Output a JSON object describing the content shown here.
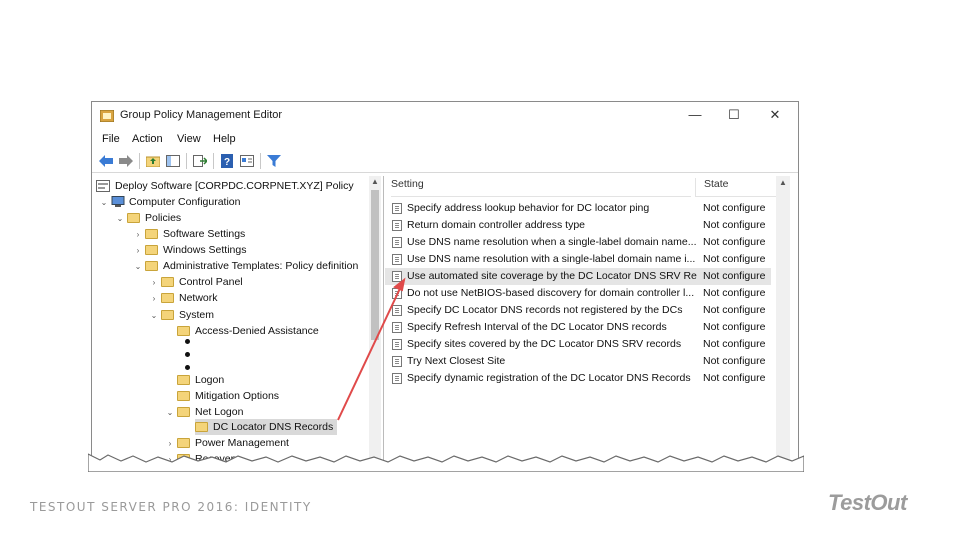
{
  "window": {
    "title": "Group Policy Management Editor",
    "minimize": "—",
    "maximize": "☐",
    "close": "✕"
  },
  "menu": [
    "File",
    "Action",
    "View",
    "Help"
  ],
  "tree": {
    "root": "Deploy Software [CORPDC.CORPNET.XYZ] Policy",
    "computer_configuration": "Computer Configuration",
    "policies": "Policies",
    "software_settings": "Software Settings",
    "windows_settings": "Windows Settings",
    "admin_templates": "Administrative Templates: Policy definition",
    "control_panel": "Control Panel",
    "network": "Network",
    "system": "System",
    "access_denied": "Access-Denied Assistance",
    "logon": "Logon",
    "mitigation": "Mitigation Options",
    "net_logon": "Net Logon",
    "dc_locator": "DC Locator DNS Records",
    "power_management": "Power Management",
    "recovery": "Recovery"
  },
  "list": {
    "col_setting": "Setting",
    "col_state": "State",
    "rows": [
      {
        "setting": "Specify address lookup behavior for DC locator ping",
        "state": "Not configure"
      },
      {
        "setting": "Return domain controller address type",
        "state": "Not configure"
      },
      {
        "setting": "Use DNS name resolution when a single-label domain name...",
        "state": "Not configure"
      },
      {
        "setting": "Use DNS name resolution with a single-label domain name i...",
        "state": "Not configure"
      },
      {
        "setting": "Use automated site coverage by the DC Locator DNS SRV Re...",
        "state": "Not configure"
      },
      {
        "setting": "Do not use NetBIOS-based discovery for domain controller l...",
        "state": "Not configure"
      },
      {
        "setting": "Specify DC Locator DNS records not registered by the DCs",
        "state": "Not configure"
      },
      {
        "setting": "Specify Refresh Interval of the DC Locator DNS records",
        "state": "Not configure"
      },
      {
        "setting": "Specify sites covered by the DC Locator DNS SRV records",
        "state": "Not configure"
      },
      {
        "setting": "Try Next Closest Site",
        "state": "Not configure"
      },
      {
        "setting": "Specify dynamic registration of the DC Locator DNS Records",
        "state": "Not configure"
      }
    ]
  },
  "footer": {
    "course": "TESTOUT SERVER PRO 2016: IDENTITY",
    "logo": "TestOut"
  },
  "colors": {
    "annotation_arrow": "#e04a4a",
    "folder": "#f4d47a",
    "selected_row": "#e5e5e5"
  },
  "icons": [
    "back-arrow-icon",
    "forward-arrow-icon",
    "up-folder-icon",
    "show-hide-tree-icon",
    "export-list-icon",
    "help-icon",
    "properties-icon",
    "filter-icon"
  ]
}
